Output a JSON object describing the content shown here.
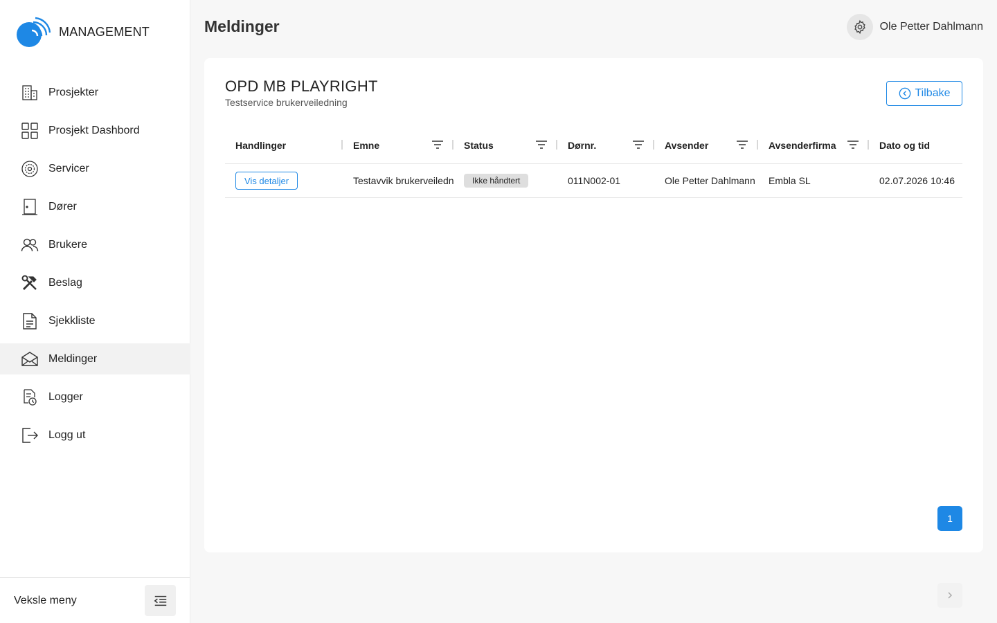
{
  "app": {
    "logo_text": "MANAGEMENT"
  },
  "sidebar": {
    "items": [
      {
        "label": "Prosjekter",
        "icon": "building-icon"
      },
      {
        "label": "Prosjekt Dashbord",
        "icon": "grid-icon"
      },
      {
        "label": "Servicer",
        "icon": "service-gear-icon"
      },
      {
        "label": "Dører",
        "icon": "door-icon"
      },
      {
        "label": "Brukere",
        "icon": "users-icon"
      },
      {
        "label": "Beslag",
        "icon": "tools-icon"
      },
      {
        "label": "Sjekkliste",
        "icon": "document-icon"
      },
      {
        "label": "Meldinger",
        "icon": "envelope-icon",
        "active": true
      },
      {
        "label": "Logger",
        "icon": "log-clock-icon"
      },
      {
        "label": "Logg ut",
        "icon": "logout-icon"
      }
    ],
    "footer_label": "Veksle meny"
  },
  "header": {
    "title": "Meldinger",
    "user_name": "Ole Petter Dahlmann"
  },
  "card": {
    "title": "OPD MB PLAYRIGHT",
    "subtitle": "Testservice brukerveiledning",
    "back_label": "Tilbake"
  },
  "table": {
    "columns": [
      "Handlinger",
      "Emne",
      "Status",
      "Dørnr.",
      "Avsender",
      "Avsenderfirma",
      "Dato og tid"
    ],
    "rows": [
      {
        "action_label": "Vis detaljer",
        "subject": "Testavvik brukerveiledn",
        "status": "Ikke håndtert",
        "door": "011N002-01",
        "sender": "Ole Petter Dahlmann",
        "company": "Embla SL",
        "datetime": "02.07.2026 10:46"
      }
    ]
  },
  "pagination": {
    "current_page": "1"
  },
  "colors": {
    "accent": "#1e88e5",
    "logo_blue": "#1e88e5",
    "badge_bg": "#dedede",
    "active_nav_bg": "#f2f2f2"
  }
}
